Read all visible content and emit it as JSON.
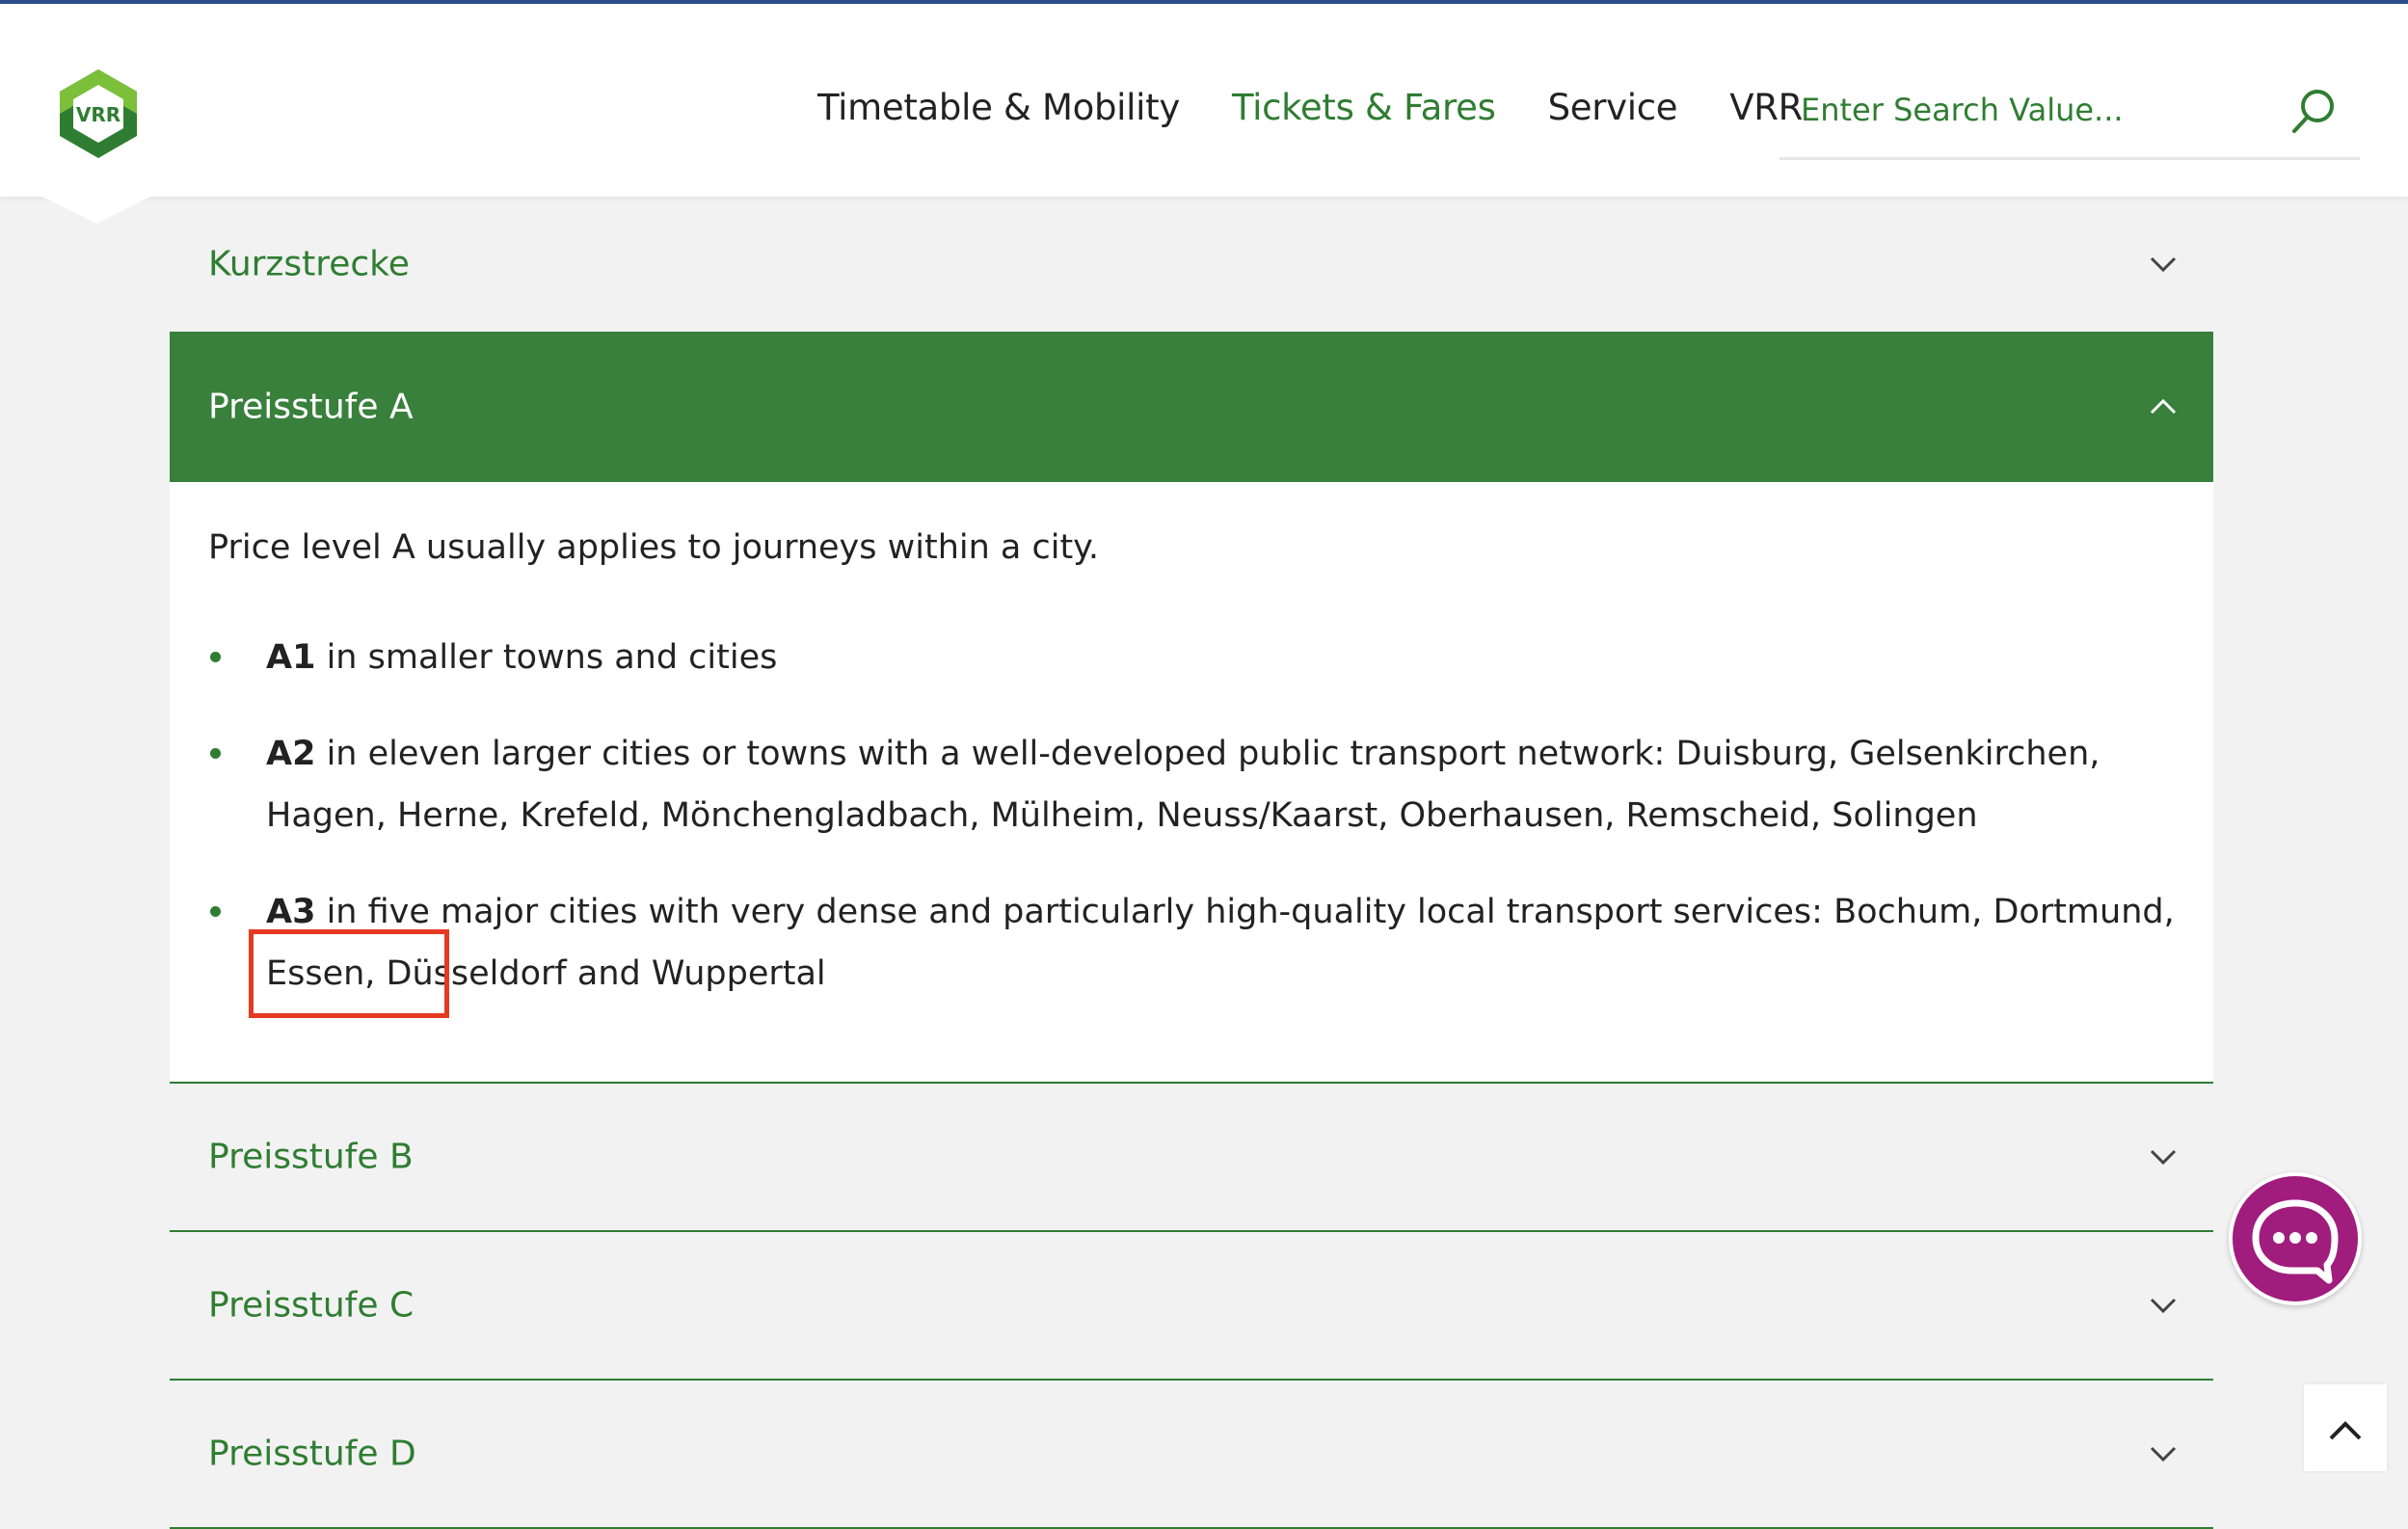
{
  "logo": {
    "text": "VRR"
  },
  "nav": {
    "items": [
      {
        "label": "Timetable & Mobility",
        "active": false
      },
      {
        "label": "Tickets & Fares",
        "active": true
      },
      {
        "label": "Service",
        "active": false
      },
      {
        "label": "VRR",
        "active": false
      }
    ]
  },
  "search": {
    "placeholder": "Enter Search Value...",
    "value": ""
  },
  "accordion": {
    "kurzstrecke": {
      "title": "Kurzstrecke"
    },
    "preisstufe_a": {
      "title": "Preisstufe A",
      "intro": "Price level A usually applies to journeys within a city.",
      "bullets": [
        {
          "code": "A1",
          "text": " in smaller towns and cities"
        },
        {
          "code": "A2",
          "text": " in eleven larger cities or towns with a well-developed public transport network: Duisburg, Gelsenkirchen, Hagen, Herne, Krefeld, Mönchengladbach, Mülheim, Neuss/Kaarst, Oberhausen, Remscheid, Solingen"
        },
        {
          "code": "A3",
          "text": " in five major cities with very dense and particularly high-quality local transport services: Bochum, Dortmund, Essen, Düsseldorf and Wuppertal"
        }
      ]
    },
    "preisstufe_b": {
      "title": "Preisstufe B"
    },
    "preisstufe_c": {
      "title": "Preisstufe C"
    },
    "preisstufe_d": {
      "title": "Preisstufe D"
    }
  },
  "colors": {
    "brand_green": "#38803c",
    "text_green": "#2f7d32",
    "chat": "#a01c7d",
    "highlight": "#e53a22"
  }
}
